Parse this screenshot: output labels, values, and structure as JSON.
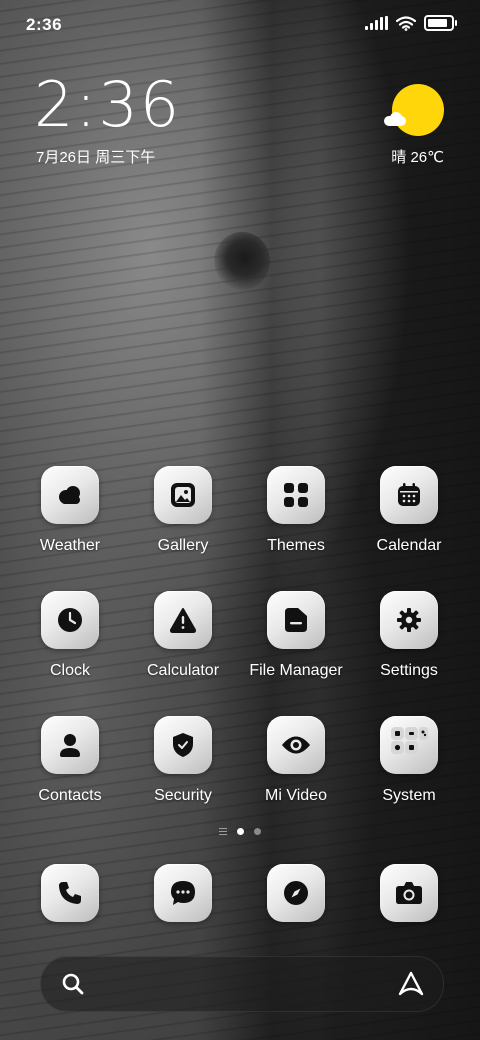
{
  "status_bar": {
    "time": "2:36",
    "battery_level": 0.85
  },
  "clock_widget": {
    "time": "2:36",
    "date": "7月26日 周三下午"
  },
  "weather_widget": {
    "condition": "晴",
    "temperature": "26℃",
    "sun_color": "#ffd60a"
  },
  "apps": [
    {
      "label": "Weather",
      "icon": "cloud-icon"
    },
    {
      "label": "Gallery",
      "icon": "image-icon"
    },
    {
      "label": "Themes",
      "icon": "grid-icon"
    },
    {
      "label": "Calendar",
      "icon": "calendar-icon"
    },
    {
      "label": "Clock",
      "icon": "clock-icon"
    },
    {
      "label": "Calculator",
      "icon": "warning-icon"
    },
    {
      "label": "File Manager",
      "icon": "folder-icon"
    },
    {
      "label": "Settings",
      "icon": "gear-icon"
    },
    {
      "label": "Contacts",
      "icon": "person-icon"
    },
    {
      "label": "Security",
      "icon": "shield-icon"
    },
    {
      "label": "Mi Video",
      "icon": "eye-icon"
    },
    {
      "label": "System",
      "icon": "folder-grid-icon"
    }
  ],
  "page_indicator": {
    "pages": 2,
    "current_page": 1
  },
  "dock": [
    {
      "name": "phone",
      "icon": "phone-icon"
    },
    {
      "name": "messages",
      "icon": "chat-icon"
    },
    {
      "name": "browser",
      "icon": "compass-icon"
    },
    {
      "name": "camera",
      "icon": "camera-icon"
    }
  ],
  "search_bar": {
    "left_icon": "search-icon",
    "right_icon": "assistant-icon"
  },
  "theme": {
    "text": "#ffffff",
    "icon_glyph": "#111111"
  }
}
